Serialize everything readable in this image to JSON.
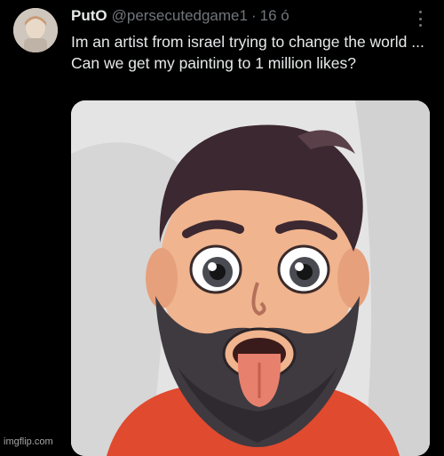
{
  "tweet": {
    "display_name": "PutO",
    "handle": "@persecutedgame1",
    "separator": "·",
    "timestamp": "16 ó",
    "text": "Im an artist from israel trying to change the world ... Can we get my painting to 1 million likes?",
    "media_icon": "cartoon-bearded-man-painting",
    "more_icon": "more-vertical-icon"
  },
  "watermark": {
    "text": "imgflip.com"
  },
  "colors": {
    "background": "#000000",
    "primary_text": "#e7e9ea",
    "secondary_text": "#71767b"
  }
}
